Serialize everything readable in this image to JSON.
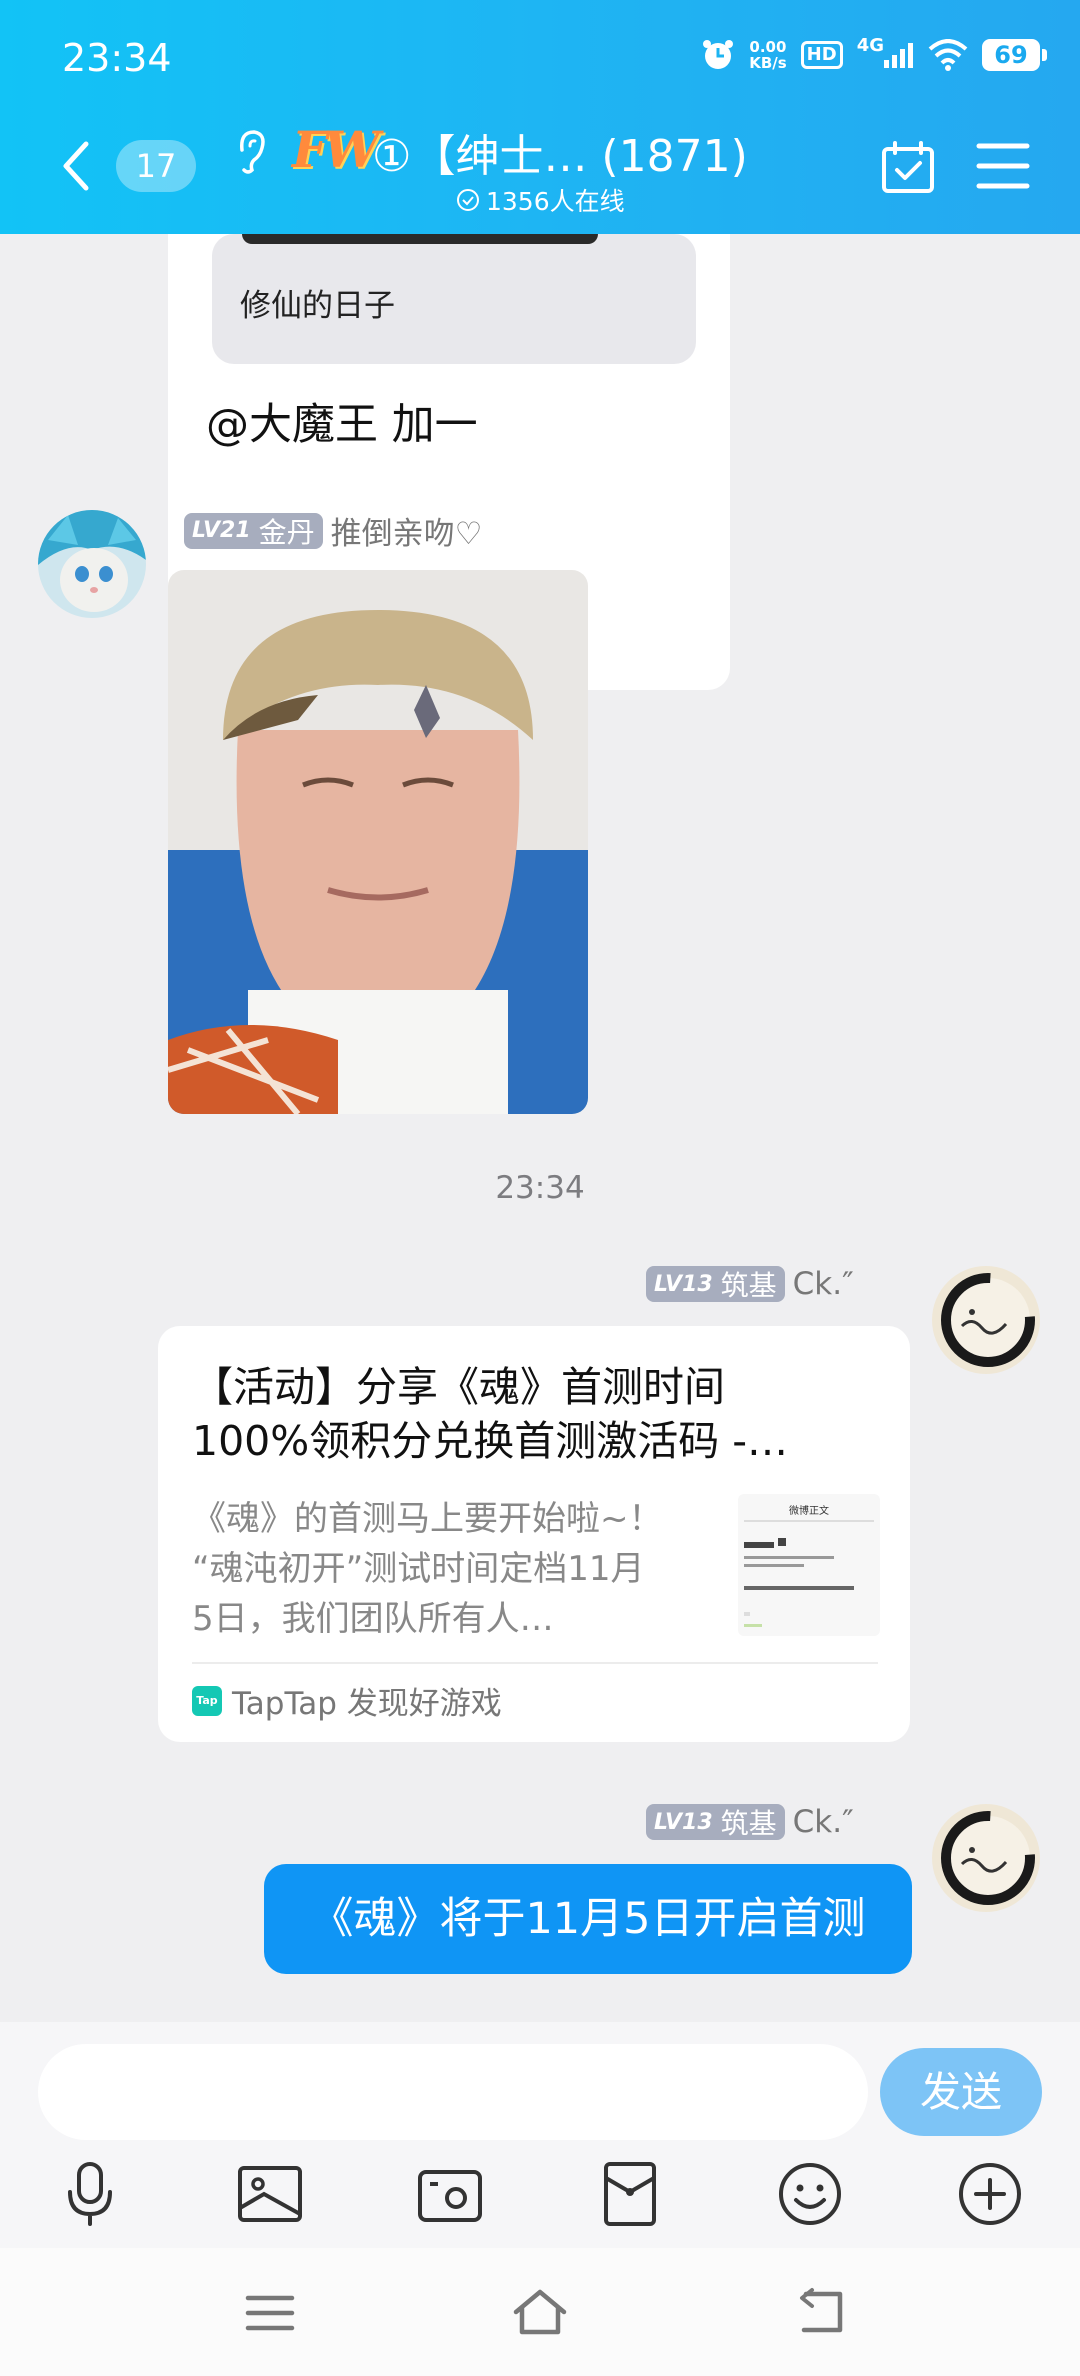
{
  "status_bar": {
    "time": "23:34",
    "net_speed_value": "0.00",
    "net_speed_unit": "KB/s",
    "hd": "HD",
    "network": "4G",
    "battery": "69"
  },
  "header": {
    "unread_count": "17",
    "logo_text": "FW",
    "title": "①【绅士…   (1871)",
    "online_status": "1356人在线"
  },
  "messages": {
    "top": {
      "quote_text": "修仙的日子",
      "text": "@大魔王 加一"
    },
    "photo_msg": {
      "level": "LV21",
      "rank": "金丹",
      "name": "推倒亲吻♡"
    },
    "timestamp": "23:34",
    "share_msg": {
      "level": "LV13",
      "rank": "筑基",
      "name": "Ck.″",
      "title_line1": "【活动】分享《魂》首测时间",
      "title_line2": "100%领积分兑换首测激活码 -…",
      "desc_line1": "《魂》的首测马上要开始啦~！",
      "desc_line2": "“魂沌初开”测试时间定档11月",
      "desc_line3": "5日，我们团队所有人…",
      "thumb_title": "微博正文",
      "source_icon": "Tap",
      "source": "TapTap 发现好游戏"
    },
    "text_msg": {
      "level": "LV13",
      "rank": "筑基",
      "name": "Ck.″",
      "text": "《魂》将于11月5日开启首测"
    }
  },
  "input": {
    "placeholder": "",
    "send_label": "发送"
  },
  "colors": {
    "header_gradient_start": "#12c3f6",
    "header_gradient_end": "#25a8f0",
    "bubble_blue": "#0f95f5",
    "send_button": "#7dc4f6",
    "level_badge": "#a7adbe"
  },
  "toolbar_icons": [
    "microphone-icon",
    "image-icon",
    "camera-icon",
    "red-packet-icon",
    "emoji-icon",
    "plus-icon"
  ]
}
